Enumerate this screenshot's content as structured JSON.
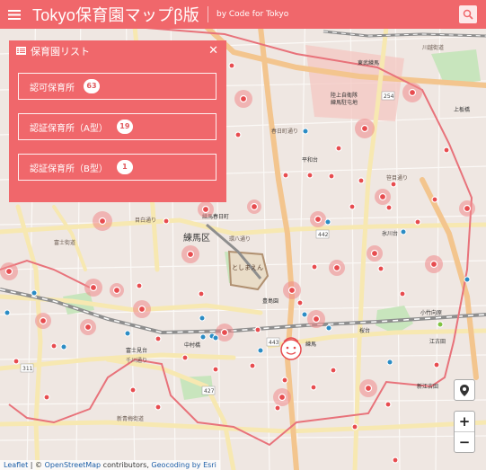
{
  "header": {
    "menu_icon": "hamburger-icon",
    "title": "Tokyo保育園マップβ版",
    "byline": "by Code for Tokyo",
    "search_icon": "search-icon"
  },
  "panel": {
    "title": "保育園リスト",
    "categories": [
      {
        "label": "認可保育所",
        "count": "63"
      },
      {
        "label": "認証保育所（A型）",
        "count": "19"
      },
      {
        "label": "認証保育所（B型）",
        "count": "1"
      }
    ]
  },
  "map": {
    "labels": {
      "nerima_ward": "練馬区",
      "toshimaen": "としまえん",
      "toshimaen_station": "豊島園",
      "nerima_station": "練馬",
      "nerima_kasugacho": "練馬春日町",
      "heiwadai": "平和台",
      "hikawadai": "氷川台",
      "kotake": "小竹向原",
      "sakuradai": "桜台",
      "ekoda": "江古田",
      "nakamurabashi": "中村橋",
      "fujimidai": "富士見台",
      "kamiitabashi": "上板橋",
      "tobu_nerima": "東武練馬",
      "shin_egota": "新江古田",
      "camp": "陸上自衛隊\n練馬駐屯地",
      "route_254": "254",
      "route_442": "442",
      "route_443": "443",
      "route_311": "311",
      "route_427": "427",
      "road_kawagoe": "川越街道",
      "road_kampachi": "環八通り",
      "road_mejiro": "目白通り",
      "road_senkawa": "千川通り",
      "road_shinoume": "新青梅街道",
      "road_kasuga": "春日町通り",
      "road_fujikaido": "富士街道",
      "road_sasame": "笹目通り"
    }
  },
  "controls": {
    "locate_icon": "location-pin-icon",
    "zoom_in": "+",
    "zoom_out": "−"
  },
  "attribution": {
    "leaflet": "Leaflet",
    "sep1": " | © ",
    "osm": "OpenStreetMap",
    "contrib": " contributors, ",
    "geocoding": "Geocoding by Esri"
  },
  "colors": {
    "brand": "#f0676b",
    "marker_red": "#e74c4f",
    "marker_blue": "#2b8cc4",
    "boundary": "#e8727a",
    "road_yellow": "#f7e8b1",
    "road_orange": "#f3c58e",
    "railway": "#8e8e8e",
    "park": "#c8e5bd",
    "map_bg": "#efe7e2"
  }
}
